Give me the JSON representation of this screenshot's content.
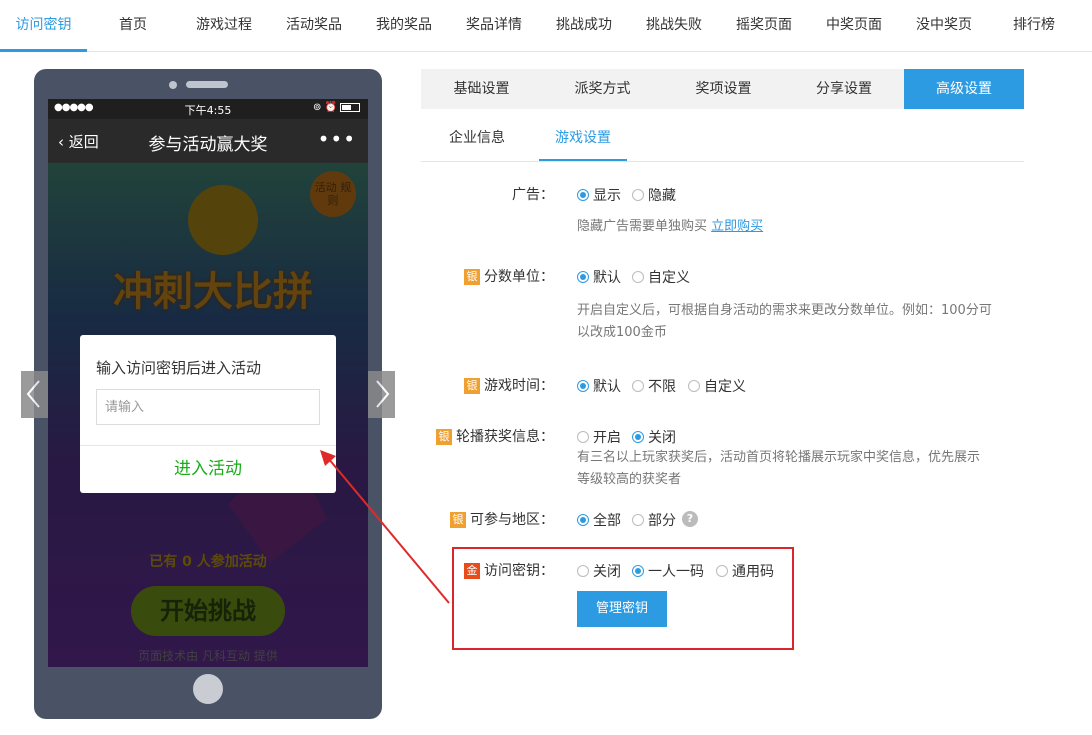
{
  "topnav": {
    "items": [
      {
        "label": "访问密钥",
        "active": true
      },
      {
        "label": "首页"
      },
      {
        "label": "游戏过程"
      },
      {
        "label": "活动奖品"
      },
      {
        "label": "我的奖品"
      },
      {
        "label": "奖品详情"
      },
      {
        "label": "挑战成功"
      },
      {
        "label": "挑战失败"
      },
      {
        "label": "摇奖页面"
      },
      {
        "label": "中奖页面"
      },
      {
        "label": "没中奖页"
      },
      {
        "label": "排行榜"
      }
    ]
  },
  "phone": {
    "statusbar": {
      "signal": "●●●●●",
      "time": "下午4:55",
      "icons": "⊚ ⏰"
    },
    "wechat": {
      "back": "返回",
      "title": "参与活动赢大奖",
      "more": "•••"
    },
    "game": {
      "logo_text": "冲刺大比拼",
      "badge_text": "活动 规则",
      "joined_text": "已有 0 人参加活动",
      "start_button": "开始挑战",
      "footer": "页面技术由 凡科互动 提供"
    },
    "dialog": {
      "title": "输入访问密钥后进入活动",
      "placeholder": "请输入",
      "enter_button": "进入活动"
    }
  },
  "tabs": {
    "items": [
      {
        "label": "基础设置"
      },
      {
        "label": "派奖方式"
      },
      {
        "label": "奖项设置"
      },
      {
        "label": "分享设置"
      },
      {
        "label": "高级设置",
        "active": true
      }
    ]
  },
  "subtabs": {
    "items": [
      {
        "label": "企业信息"
      },
      {
        "label": "游戏设置",
        "active": true
      }
    ]
  },
  "settings": {
    "ad": {
      "label": "广告：",
      "options": [
        "显示",
        "隐藏"
      ],
      "selected": 0,
      "desc": "隐藏广告需要单独购买",
      "buy_link": "立即购买"
    },
    "score_unit": {
      "tag": "银",
      "label": "分数单位：",
      "options": [
        "默认",
        "自定义"
      ],
      "selected": 0,
      "desc_line1": "开启自定义后，可根据自身活动的需求来更改分数单位。例如：100分可",
      "desc_line2": "以改成100金币"
    },
    "game_time": {
      "tag": "银",
      "label": "游戏时间：",
      "options": [
        "默认",
        "不限",
        "自定义"
      ],
      "selected": 0
    },
    "carousel": {
      "tag": "银",
      "label": "轮播获奖信息：",
      "options": [
        "开启",
        "关闭"
      ],
      "selected": 1,
      "desc_line1": "有三名以上玩家获奖后，活动首页将轮播展示玩家中奖信息，优先展示",
      "desc_line2": "等级较高的获奖者"
    },
    "region": {
      "tag": "银",
      "label": "可参与地区：",
      "options": [
        "全部",
        "部分"
      ],
      "selected": 0,
      "help": "?"
    },
    "access_key": {
      "tag": "金",
      "label": "访问密钥：",
      "options": [
        "关闭",
        "一人一码",
        "通用码"
      ],
      "selected": 1,
      "manage_button": "管理密钥"
    }
  },
  "colors": {
    "accent": "#2d9be2",
    "highlight_box": "#d9262c",
    "enter_green": "#1aad19",
    "silver_tag": "#f0a030",
    "gold_tag": "#e84c1a"
  }
}
